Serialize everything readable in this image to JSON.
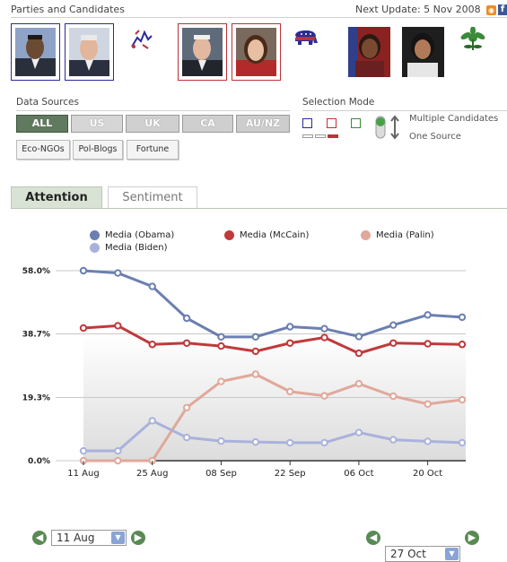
{
  "header": {
    "title": "Parties and Candidates",
    "next_update": "Next Update: 5 Nov 2008"
  },
  "data_sources": {
    "label": "Data Sources",
    "buttons": [
      "ALL",
      "US",
      "UK",
      "CA",
      "AU/NZ"
    ],
    "active": "ALL",
    "filters": [
      "Eco-NGOs",
      "Pol-Blogs",
      "Fortune"
    ]
  },
  "selection_mode": {
    "label": "Selection Mode",
    "options": [
      "Multiple Candidates",
      "One Source"
    ]
  },
  "tabs": {
    "attention": "Attention",
    "sentiment": "Sentiment",
    "active": "Attention"
  },
  "colors": {
    "obama": "#6b7fb0",
    "mccain": "#c0393b",
    "palin": "#e0a89a",
    "biden": "#a9b2dc",
    "active_button": "#5f7a5f",
    "nav_green": "#5a8a54"
  },
  "chart_data": {
    "type": "line",
    "x": [
      "11 Aug",
      "18 Aug",
      "25 Aug",
      "01 Sep",
      "08 Sep",
      "15 Sep",
      "22 Sep",
      "29 Sep",
      "06 Oct",
      "13 Oct",
      "20 Oct",
      "27 Oct"
    ],
    "x_tick_labels": [
      "11 Aug",
      "25 Aug",
      "08 Sep",
      "22 Sep",
      "06 Oct",
      "20 Oct"
    ],
    "y_tick_labels": [
      "58.0%",
      "38.7%",
      "19.3%",
      "0.0%"
    ],
    "ylim": [
      0,
      58.0
    ],
    "legend_position": "top",
    "grid": true,
    "series": [
      {
        "name": "Media (Obama)",
        "color": "#6b7fb0",
        "values": [
          58.0,
          57.3,
          53.2,
          43.5,
          37.8,
          37.8,
          40.9,
          40.3,
          37.9,
          41.4,
          44.5,
          43.8
        ]
      },
      {
        "name": "Media (McCain)",
        "color": "#c0393b",
        "values": [
          40.5,
          41.2,
          35.5,
          35.9,
          35.0,
          33.4,
          35.9,
          37.6,
          32.8,
          35.9,
          35.7,
          35.5
        ]
      },
      {
        "name": "Media (Palin)",
        "color": "#e0a89a",
        "values": [
          0.0,
          0.0,
          0.0,
          16.2,
          24.2,
          26.4,
          21.1,
          19.8,
          23.5,
          19.7,
          17.3,
          18.6
        ]
      },
      {
        "name": "Media (Biden)",
        "color": "#a9b2dc",
        "values": [
          3.0,
          3.0,
          12.2,
          7.1,
          6.0,
          5.7,
          5.5,
          5.5,
          8.6,
          6.4,
          5.9,
          5.5
        ]
      }
    ]
  },
  "footer": {
    "start_date": "11 Aug",
    "end_date": "27 Oct"
  }
}
